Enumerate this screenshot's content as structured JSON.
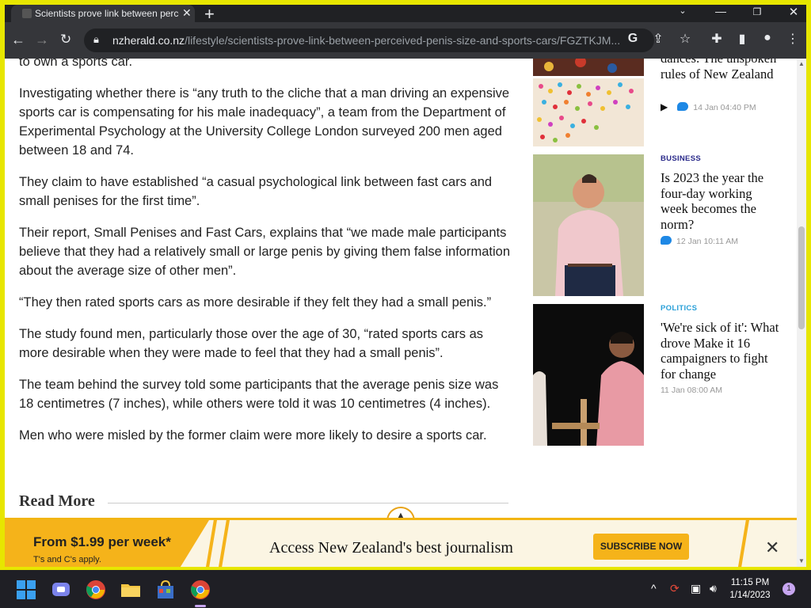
{
  "browser": {
    "tab_title": "Scientists prove link between perceived penis size and sports cars",
    "url_host": "nzherald.co.nz",
    "url_path": "/lifestyle/scientists-prove-link-between-perceived-penis-size-and-sports-cars/FGZTKJM...",
    "new_tab_label": "+",
    "close_tab_label": "✕"
  },
  "article": {
    "paragraphs": [
      "to own a sports car.",
      "Investigating whether there is “any truth to the cliche that a man driving an expensive sports car is compensating for his male inadequacy”, a team from the Department of Experimental Psychology at the University College London surveyed 200 men aged between 18 and 74.",
      "They claim to have established “a casual psychological link between fast cars and small penises for the first time”.",
      "Their report, Small Penises and Fast Cars, explains that “we made male participants believe that they had a relatively small or large penis by giving them false information about the average size of other men”.",
      "“They then rated sports cars as more desirable if they felt they had a small penis.”",
      "The study found men, particularly those over the age of 30, “rated sports cars as more desirable when they were made to feel that they had a small penis”.",
      "The team behind the survey told some participants that the average penis size was 18 centimetres (7 inches), while others were told it was 10 centimetres (4 inches).",
      "Men who were misled by the former claim were more likely to desire a sports car."
    ],
    "read_more": "Read More"
  },
  "sidebar": [
    {
      "category": "",
      "headline": "dances: The unspoken rules of New Zealand",
      "meta": "14 Jan 04:40 PM"
    },
    {
      "category": "BUSINESS",
      "category_color": "#2a2a8a",
      "headline": "Is 2023 the year the four-day working week becomes the norm?",
      "meta": "12 Jan 10:11 AM"
    },
    {
      "category": "POLITICS",
      "category_color": "#2aa0d8",
      "headline": "'We're sick of it': What drove Make it 16 campaigners to fight for change",
      "meta": "11 Jan 08:00 AM"
    }
  ],
  "banner": {
    "price": "From $1.99 per week*",
    "tcs": "T's and C's apply.",
    "pitch": "Access New Zealand's best journalism",
    "subscribe": "SUBSCRIBE NOW",
    "close": "✕"
  },
  "taskbar": {
    "time": "11:15 PM",
    "date": "1/14/2023",
    "notifications": "1"
  }
}
